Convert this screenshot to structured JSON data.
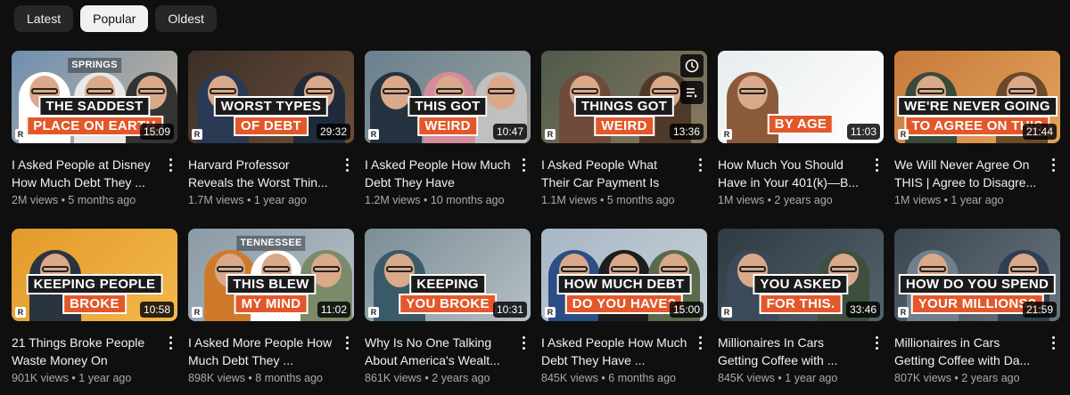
{
  "filters": [
    {
      "label": "Latest",
      "active": false
    },
    {
      "label": "Popular",
      "active": true
    },
    {
      "label": "Oldest",
      "active": false
    }
  ],
  "videos": [
    {
      "title": "I Asked People at Disney How Much Debt They ...",
      "views": "2M views",
      "age": "5 months ago",
      "duration": "15:09",
      "thumb_caption": [
        "THE SADDEST",
        "PLACE ON EARTH"
      ],
      "thumb_text": "SPRINGS",
      "palette": [
        "#6d8fb3",
        "#c9b79c"
      ]
    },
    {
      "title": "Harvard Professor Reveals the Worst Thin...",
      "views": "1.7M views",
      "age": "1 year ago",
      "duration": "29:32",
      "thumb_caption": [
        "WORST TYPES",
        "OF DEBT"
      ],
      "palette": [
        "#3b2f27",
        "#6b4f3a"
      ]
    },
    {
      "title": "I Asked People How Much Debt They Have",
      "views": "1.2M views",
      "age": "10 months ago",
      "duration": "10:47",
      "thumb_caption": [
        "THIS GOT",
        "WEIRD"
      ],
      "palette": [
        "#6a7f8f",
        "#9aa39c"
      ]
    },
    {
      "title": "I Asked People What Their Car Payment Is",
      "views": "1.1M views",
      "age": "5 months ago",
      "duration": "13:36",
      "thumb_caption": [
        "THINGS GOT",
        "WEIRD"
      ],
      "palette": [
        "#4e5a4a",
        "#8a7a62"
      ]
    },
    {
      "title": "How Much You Should Have in Your 401(k)—B...",
      "views": "1M views",
      "age": "2 years ago",
      "duration": "11:03",
      "thumb_caption": [
        "BY AGE"
      ],
      "palette": [
        "#e8ecee",
        "#ffffff"
      ]
    },
    {
      "title": "We Will Never Agree On THIS | Agree to Disagre...",
      "views": "1M views",
      "age": "1 year ago",
      "duration": "21:44",
      "thumb_caption": [
        "WE'RE NEVER GOING",
        "TO AGREE ON THIS"
      ],
      "palette": [
        "#c77a3c",
        "#e2a35a"
      ]
    },
    {
      "title": "21 Things Broke People Waste Money On",
      "views": "901K views",
      "age": "1 year ago",
      "duration": "10:58",
      "thumb_caption": [
        "KEEPING PEOPLE",
        "BROKE"
      ],
      "palette": [
        "#e39a2a",
        "#f2b84a"
      ]
    },
    {
      "title": "I Asked More People How Much Debt They ...",
      "views": "898K views",
      "age": "8 months ago",
      "duration": "11:02",
      "thumb_caption": [
        "THIS BLEW",
        "MY MIND"
      ],
      "thumb_text": "TENNESSEE",
      "palette": [
        "#8a9aa6",
        "#b7c0c5"
      ]
    },
    {
      "title": "Why Is No One Talking About America's Wealt...",
      "views": "861K views",
      "age": "2 years ago",
      "duration": "10:31",
      "thumb_caption": [
        "KEEPING",
        "YOU BROKE"
      ],
      "palette": [
        "#7b8d95",
        "#b4bfc4"
      ]
    },
    {
      "title": "I Asked People How Much Debt They Have ...",
      "views": "845K views",
      "age": "6 months ago",
      "duration": "15:00",
      "thumb_caption": [
        "HOW MUCH DEBT",
        "DO YOU HAVE?"
      ],
      "palette": [
        "#a8b7c6",
        "#c6cfd6"
      ]
    },
    {
      "title": "Millionaires In Cars Getting Coffee with ...",
      "views": "845K views",
      "age": "1 year ago",
      "duration": "33:46",
      "thumb_caption": [
        "YOU ASKED",
        "FOR THIS."
      ],
      "palette": [
        "#2f3a42",
        "#54636d"
      ]
    },
    {
      "title": "Millionaires in Cars Getting Coffee with Da...",
      "views": "807K views",
      "age": "2 years ago",
      "duration": "21:59",
      "thumb_caption": [
        "HOW DO YOU SPEND",
        "YOUR MILLIONS?"
      ],
      "palette": [
        "#3a4550",
        "#6a7580"
      ]
    }
  ]
}
